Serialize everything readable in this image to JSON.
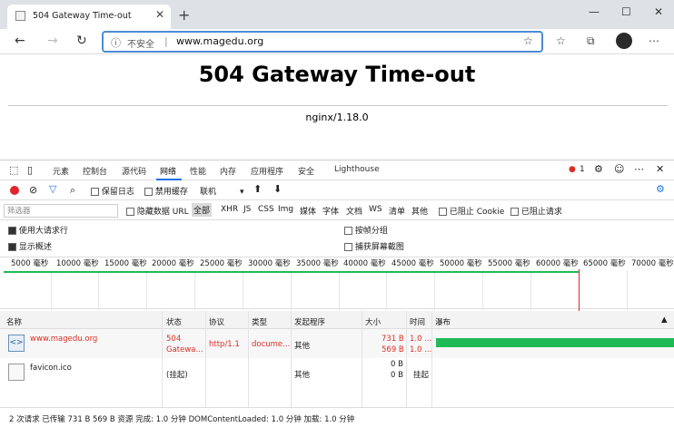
{
  "browser": {
    "tab_title": "504 Gateway Time-out",
    "new_tab": "+",
    "address": {
      "security": "不安全",
      "separator": "|",
      "url": "www.magedu.org"
    }
  },
  "page": {
    "heading": "504 Gateway Time-out",
    "server": "nginx/1.18.0"
  },
  "devtools": {
    "tabs": [
      "元素",
      "控制台",
      "源代码",
      "网络",
      "性能",
      "内存",
      "应用程序",
      "安全",
      "Lighthouse"
    ],
    "active_tab": "网络",
    "error_count": "1",
    "toolbar": {
      "preserve_log": "保留日志",
      "disable_cache": "禁用缓存",
      "throttle": "联机"
    },
    "filter": {
      "placeholder": "筛选器",
      "hide_data_urls": "隐藏数据 URL",
      "types": [
        "全部",
        "XHR",
        "JS",
        "CSS",
        "Img",
        "媒体",
        "字体",
        "文档",
        "WS",
        "清单",
        "其他"
      ],
      "blocked_cookies": "已阻止 Cookie",
      "blocked_requests": "已阻止请求"
    },
    "settings": {
      "large_rows": "使用大请求行",
      "show_overview": "显示概述",
      "group_by_frame": "按帧分组",
      "capture_screenshots": "捕获屏幕截图"
    },
    "overview_ticks": [
      "5000 毫秒",
      "10000 毫秒",
      "15000 毫秒",
      "20000 毫秒",
      "25000 毫秒",
      "30000 毫秒",
      "35000 毫秒",
      "40000 毫秒",
      "45000 毫秒",
      "50000 毫秒",
      "55000 毫秒",
      "60000 毫秒",
      "65000 毫秒",
      "70000 毫秒"
    ],
    "columns": [
      "名称",
      "状态",
      "协议",
      "类型",
      "发起程序",
      "大小",
      "时间",
      "瀑布"
    ],
    "rows": [
      {
        "name": "www.magedu.org",
        "status1": "504",
        "status2": "Gatewa...",
        "protocol": "http/1.1",
        "type": "docume...",
        "initiator": "其他",
        "size1": "731 B",
        "size2": "569 B",
        "time1": "1.0 ...",
        "time2": "1.0 ..."
      },
      {
        "name": "favicon.ico",
        "status1": "(挂起)",
        "status2": "",
        "protocol": "",
        "type": "",
        "initiator": "其他",
        "size1": "0 B",
        "size2": "0 B",
        "time1": "挂起",
        "time2": ""
      }
    ],
    "status_bar": "2 次请求  已传输 731 B  569 B 资源  完成: 1.0 分钟  DOMContentLoaded: 1.0 分钟  加载: 1.0 分钟",
    "colors": {
      "accent": "#1a73e8",
      "error": "#d93025",
      "waterfall": "#1fba56"
    }
  }
}
